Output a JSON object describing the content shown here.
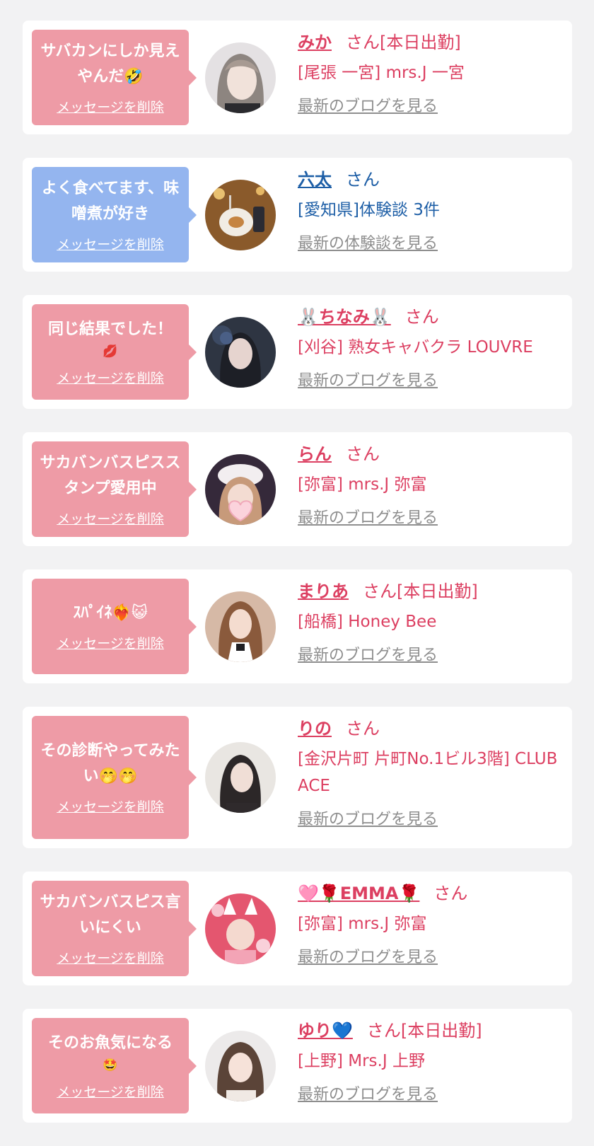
{
  "delete_label": "メッセージを削除",
  "items": [
    {
      "message": "サバカンにしか見えやんだ🤣",
      "bubble_emoji": "",
      "name": "みか",
      "suffix": "さん[本日出勤]",
      "shop": "[尾張 一宮] mrs.J 一宮",
      "link": "最新のブログを見る"
    },
    {
      "message": "よく食べてます、味噌煮が好き",
      "bubble_emoji": "",
      "name": "六太",
      "suffix": "さん",
      "shop": "[愛知県]体験談 3件",
      "link": "最新の体験談を見る"
    },
    {
      "message": "同じ結果でした！",
      "bubble_emoji": "💋",
      "name": "🐰ちなみ🐰",
      "suffix": "さん",
      "shop": "[刈谷] 熟女キャバクラ LOUVRE",
      "link": "最新のブログを見る"
    },
    {
      "message": "サカバンバスピススタンプ愛用中",
      "bubble_emoji": "",
      "name": "らん",
      "suffix": "さん",
      "shop": "[弥富] mrs.J 弥富",
      "link": "最新のブログを見る"
    },
    {
      "message": "ｽﾊﾟｲﾈ❤️‍🔥😺",
      "bubble_emoji": "",
      "name": "まりあ",
      "suffix": "さん[本日出勤]",
      "shop": "[船橋] Honey Bee",
      "link": "最新のブログを見る"
    },
    {
      "message": "その診断やってみたい🤭🤭",
      "bubble_emoji": "",
      "name": "りの",
      "suffix": "さん",
      "shop": "[金沢片町 片町No.1ビル3階] CLUB ACE",
      "link": "最新のブログを見る"
    },
    {
      "message": "サカバンバスピス言いにくい",
      "bubble_emoji": "",
      "name": "🩷🌹EMMA🌹",
      "suffix": "さん",
      "shop": "[弥富] mrs.J 弥富",
      "link": "最新のブログを見る"
    },
    {
      "message": "そのお魚気になる",
      "bubble_emoji": "🤩",
      "name": "ゆり💙",
      "suffix": "さん[本日出勤]",
      "shop": "[上野] Mrs.J 上野",
      "link": "最新のブログを見る"
    }
  ]
}
